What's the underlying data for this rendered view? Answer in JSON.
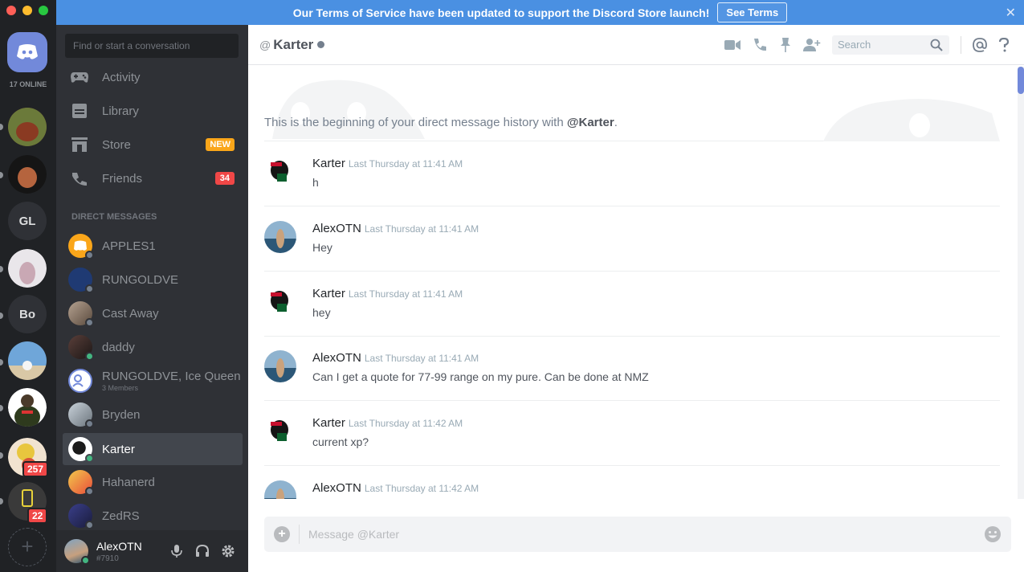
{
  "banner": {
    "message": "Our Terms of Service have been updated to support the Discord Store launch!",
    "button": "See Terms",
    "close": "✕"
  },
  "rail": {
    "online": "17 ONLINE",
    "servers": [
      {
        "label": "",
        "bg": "#7a5a2e"
      },
      {
        "label": "",
        "bg": "#5b2a1a"
      },
      {
        "label": "GL",
        "bg": "#2f3136"
      },
      {
        "label": "",
        "bg": "#d9d4d8"
      },
      {
        "label": "Bo",
        "bg": "#2f3136"
      },
      {
        "label": "",
        "bg": "#c4613a"
      },
      {
        "label": "",
        "bg": "#2a3319"
      },
      {
        "label": "",
        "bg": "#e8c63e",
        "badge": "257"
      },
      {
        "label": "",
        "bg": "#333333",
        "badge": "22"
      }
    ]
  },
  "sidebar": {
    "search_placeholder": "Find or start a conversation",
    "nav": [
      {
        "label": "Activity",
        "icon": "controller-icon"
      },
      {
        "label": "Library",
        "icon": "library-icon"
      },
      {
        "label": "Store",
        "icon": "store-icon",
        "badge": "NEW"
      },
      {
        "label": "Friends",
        "icon": "friends-icon",
        "badge": "34"
      }
    ],
    "dm_header": "DIRECT MESSAGES",
    "dms": [
      {
        "name": "APPLES1",
        "bg": "#faa61a",
        "status": "offline"
      },
      {
        "name": "RUNGOLDVE",
        "bg": "#1f3a73",
        "status": "offline"
      },
      {
        "name": "Cast Away",
        "bg": "#8a7766",
        "status": "offline"
      },
      {
        "name": "daddy",
        "bg": "#3c2d2b",
        "status": "online"
      },
      {
        "name": "RUNGOLDVE, Ice Queen",
        "sub": "3 Members",
        "bg": "#7289da",
        "status": "none"
      },
      {
        "name": "Bryden",
        "bg": "#a8b2bb",
        "status": "offline"
      },
      {
        "name": "Karter",
        "bg": "#ffffff",
        "status": "online",
        "active": true
      },
      {
        "name": "Hahanerd",
        "bg": "#e94d3a",
        "status": "offline"
      },
      {
        "name": "ZedRS",
        "bg": "#2a2f66",
        "status": "offline"
      }
    ],
    "user": {
      "name": "AlexOTN",
      "tag": "#7910"
    }
  },
  "main": {
    "header": {
      "at": "@",
      "title": "Karter",
      "search_placeholder": "Search"
    },
    "beginning_text": "This is the beginning of your direct message history with ",
    "beginning_user": "@Karter",
    "beginning_period": ".",
    "messages": [
      {
        "author": "Karter",
        "time": "Last Thursday at 11:41 AM",
        "text": "h",
        "avatar": "karter"
      },
      {
        "author": "AlexOTN",
        "time": "Last Thursday at 11:41 AM",
        "text": "Hey",
        "avatar": "alex"
      },
      {
        "author": "Karter",
        "time": "Last Thursday at 11:41 AM",
        "text": "hey",
        "avatar": "karter"
      },
      {
        "author": "AlexOTN",
        "time": "Last Thursday at 11:41 AM",
        "text": "Can I get a quote for 77-99 range on my pure. Can be done at NMZ",
        "avatar": "alex"
      },
      {
        "author": "Karter",
        "time": "Last Thursday at 11:42 AM",
        "text": "current xp?",
        "avatar": "karter"
      },
      {
        "author": "AlexOTN",
        "time": "Last Thursday at 11:42 AM",
        "text": "",
        "avatar": "alex"
      }
    ],
    "composer_placeholder": "Message @Karter"
  },
  "colors": {
    "blurple": "#7289da",
    "banner": "#4a90e2",
    "online": "#43b581",
    "danger": "#f04747",
    "warning": "#faa61a"
  }
}
